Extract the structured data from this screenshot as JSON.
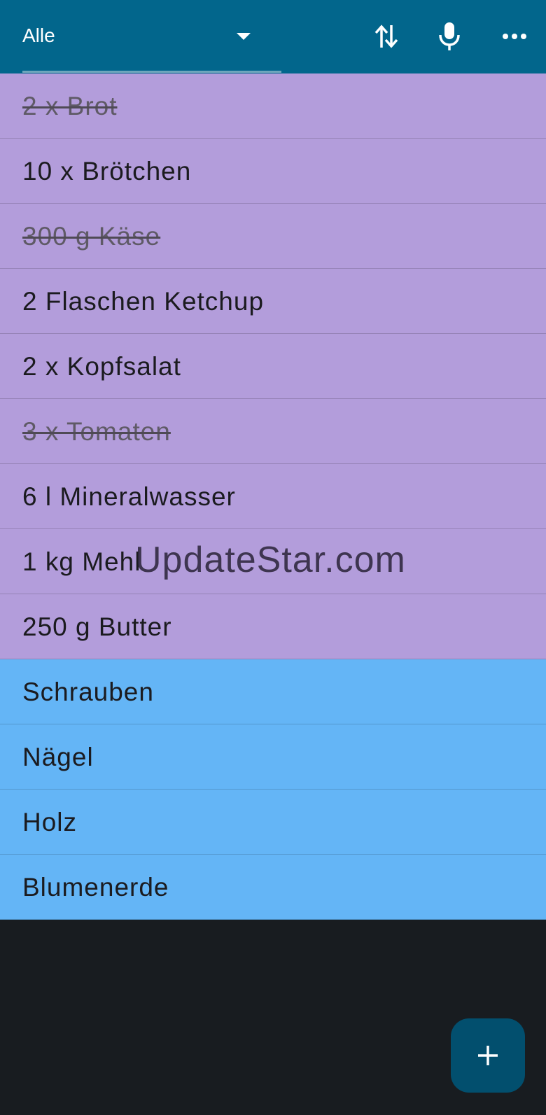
{
  "toolbar": {
    "list_selector_value": "Alle",
    "actions": [
      {
        "name": "sort",
        "icon": "swap-vertical-icon"
      },
      {
        "name": "voice-input",
        "icon": "microphone-icon"
      },
      {
        "name": "more-options",
        "icon": "more-horizontal-icon"
      }
    ]
  },
  "items": [
    {
      "text": "2 x Brot",
      "checked": true,
      "group": "lebensmittel"
    },
    {
      "text": "10 x Brötchen",
      "checked": false,
      "group": "lebensmittel"
    },
    {
      "text": "300 g Käse",
      "checked": true,
      "group": "lebensmittel"
    },
    {
      "text": "2 Flaschen Ketchup",
      "checked": false,
      "group": "lebensmittel"
    },
    {
      "text": "2 x Kopfsalat",
      "checked": false,
      "group": "lebensmittel"
    },
    {
      "text": "3 x Tomaten",
      "checked": true,
      "group": "lebensmittel"
    },
    {
      "text": "6 l Mineralwasser",
      "checked": false,
      "group": "lebensmittel"
    },
    {
      "text": "1 kg Mehl",
      "checked": false,
      "group": "lebensmittel"
    },
    {
      "text": "250 g Butter",
      "checked": false,
      "group": "lebensmittel"
    },
    {
      "text": "Schrauben",
      "checked": false,
      "group": "baumarkt"
    },
    {
      "text": "Nägel",
      "checked": false,
      "group": "baumarkt"
    },
    {
      "text": "Holz",
      "checked": false,
      "group": "baumarkt"
    },
    {
      "text": "Blumenerde",
      "checked": false,
      "group": "baumarkt"
    }
  ],
  "group_colors": {
    "lebensmittel": "#b39ddb",
    "baumarkt": "#64b5f6"
  },
  "colors": {
    "toolbar": "#02668c",
    "background": "#181c20",
    "fab": "#024f6e"
  },
  "watermark": "UpdateStar.com",
  "fab": {
    "icon": "plus-icon"
  }
}
